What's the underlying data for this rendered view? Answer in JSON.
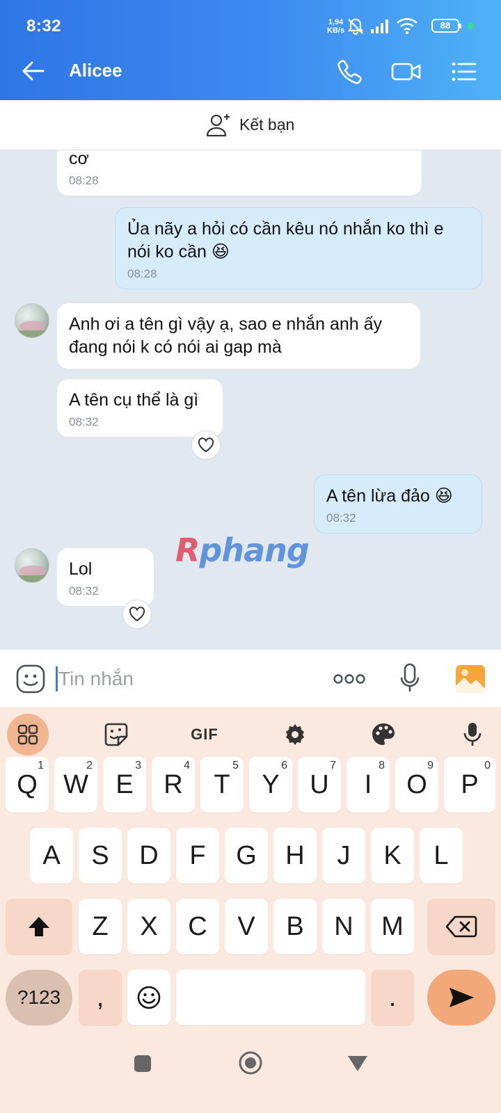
{
  "status_bar": {
    "time": "8:32",
    "speed_value": "1,94",
    "speed_unit": "KB/s",
    "battery": "88"
  },
  "header": {
    "title": "Alicee"
  },
  "friend_bar": {
    "label": "Kết bạn"
  },
  "messages": [
    {
      "direction": "in",
      "text": "cơ",
      "time": "08:28"
    },
    {
      "direction": "out",
      "text": "Ủa nãy a hỏi có cần kêu nó nhắn ko thì e nói ko cần 😆",
      "time": "08:28"
    },
    {
      "direction": "in",
      "text": "Anh ơi a tên gì vậy ạ, sao e nhắn anh ấy đang nói k có nói ai gap mà",
      "time": ""
    },
    {
      "direction": "in",
      "text": "A tên cụ thể là gì",
      "time": "08:32"
    },
    {
      "direction": "out",
      "text": "A tên lừa đảo 😆",
      "time": "08:32"
    },
    {
      "direction": "in",
      "text": "Lol",
      "time": "08:32"
    }
  ],
  "watermark": {
    "part1": "R",
    "part2": "phang"
  },
  "input": {
    "placeholder": "Tin nhắn"
  },
  "keyboard": {
    "gif_label": "GIF",
    "row1": [
      {
        "k": "Q",
        "n": "1"
      },
      {
        "k": "W",
        "n": "2"
      },
      {
        "k": "E",
        "n": "3"
      },
      {
        "k": "R",
        "n": "4"
      },
      {
        "k": "T",
        "n": "5"
      },
      {
        "k": "Y",
        "n": "6"
      },
      {
        "k": "U",
        "n": "7"
      },
      {
        "k": "I",
        "n": "8"
      },
      {
        "k": "O",
        "n": "9"
      },
      {
        "k": "P",
        "n": "0"
      }
    ],
    "row2": [
      "A",
      "S",
      "D",
      "F",
      "G",
      "H",
      "J",
      "K",
      "L"
    ],
    "row3": [
      "Z",
      "X",
      "C",
      "V",
      "B",
      "N",
      "M"
    ],
    "sym_label": "?123",
    "comma": ",",
    "period": "."
  },
  "icons": {
    "back": "arrow-left-icon",
    "call": "phone-icon",
    "video": "video-camera-icon",
    "menu": "list-menu-icon",
    "add_friend": "add-user-icon",
    "emoji": "emoji-icon",
    "more": "more-dots-icon",
    "mic": "microphone-icon",
    "gallery": "image-icon",
    "heart": "heart-icon"
  },
  "colors": {
    "header_start": "#2e76e6",
    "header_end": "#4fb3f7",
    "outgoing_bubble": "#d6ecfb",
    "incoming_bubble": "#ffffff",
    "chat_bg": "#e2e8f0",
    "keyboard_bg": "#fbe9df",
    "accent_orange": "#f2a879"
  }
}
